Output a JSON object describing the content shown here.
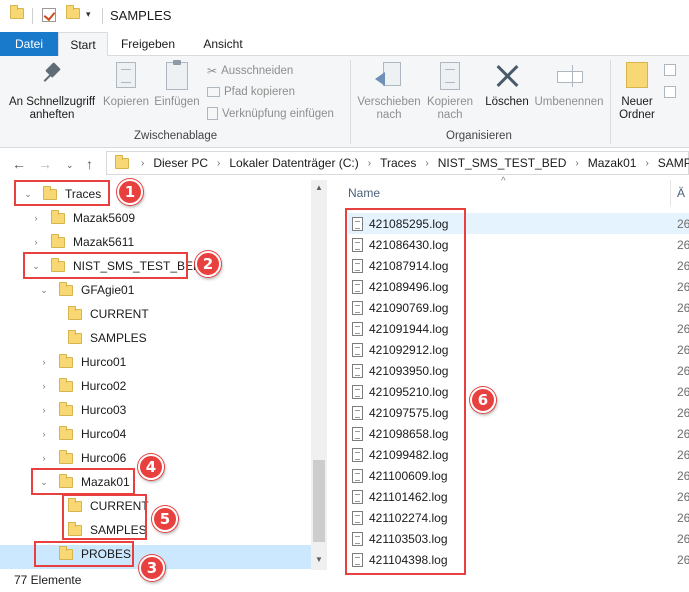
{
  "window": {
    "title": "SAMPLES"
  },
  "ribbon_tabs": [
    {
      "label": "Datei"
    },
    {
      "label": "Start"
    },
    {
      "label": "Freigeben"
    },
    {
      "label": "Ansicht"
    }
  ],
  "ribbon": {
    "pin_label": "An Schnellzugriff anheften",
    "copy_label": "Kopieren",
    "paste_label": "Einfügen",
    "cut_label": "Ausschneiden",
    "copy_path_label": "Pfad kopieren",
    "paste_shortcut_label": "Verknüpfung einfügen",
    "clipboard_group": "Zwischenablage",
    "move_to_label": "Verschieben nach",
    "copy_to_label": "Kopieren nach",
    "delete_label": "Löschen",
    "rename_label": "Umbenennen",
    "organize_group": "Organisieren",
    "new_folder_label": "Neuer Ordner"
  },
  "address": {
    "crumbs": [
      "Dieser PC",
      "Lokaler Datenträger (C:)",
      "Traces",
      "NIST_SMS_TEST_BED",
      "Mazak01",
      "SAMPLES"
    ]
  },
  "tree": [
    {
      "label": "Traces",
      "arrow": "expanded"
    },
    {
      "label": "Mazak5609",
      "arrow": "collapsed"
    },
    {
      "label": "Mazak5611",
      "arrow": "collapsed"
    },
    {
      "label": "NIST_SMS_TEST_BED",
      "arrow": "expanded"
    },
    {
      "label": "GFAgie01",
      "arrow": "expanded"
    },
    {
      "label": "CURRENT",
      "arrow": "none"
    },
    {
      "label": "SAMPLES",
      "arrow": "none"
    },
    {
      "label": "Hurco01",
      "arrow": "collapsed"
    },
    {
      "label": "Hurco02",
      "arrow": "collapsed"
    },
    {
      "label": "Hurco03",
      "arrow": "collapsed"
    },
    {
      "label": "Hurco04",
      "arrow": "collapsed"
    },
    {
      "label": "Hurco06",
      "arrow": "collapsed"
    },
    {
      "label": "Mazak01",
      "arrow": "expanded"
    },
    {
      "label": "CURRENT",
      "arrow": "none"
    },
    {
      "label": "SAMPLES",
      "arrow": "none",
      "selected": true
    },
    {
      "label": "PROBES",
      "arrow": "none"
    }
  ],
  "file_list": {
    "column_name": "Name",
    "column_date_partial": "Ä",
    "files": [
      {
        "name": "421085295.log",
        "date_partial": "26"
      },
      {
        "name": "421086430.log",
        "date_partial": "26"
      },
      {
        "name": "421087914.log",
        "date_partial": "26"
      },
      {
        "name": "421089496.log",
        "date_partial": "26"
      },
      {
        "name": "421090769.log",
        "date_partial": "26"
      },
      {
        "name": "421091944.log",
        "date_partial": "26"
      },
      {
        "name": "421092912.log",
        "date_partial": "26"
      },
      {
        "name": "421093950.log",
        "date_partial": "26"
      },
      {
        "name": "421095210.log",
        "date_partial": "26"
      },
      {
        "name": "421097575.log",
        "date_partial": "26"
      },
      {
        "name": "421098658.log",
        "date_partial": "26"
      },
      {
        "name": "421099482.log",
        "date_partial": "26"
      },
      {
        "name": "421100609.log",
        "date_partial": "26"
      },
      {
        "name": "421101462.log",
        "date_partial": "26"
      },
      {
        "name": "421102274.log",
        "date_partial": "26"
      },
      {
        "name": "421103503.log",
        "date_partial": "26"
      },
      {
        "name": "421104398.log",
        "date_partial": "26"
      }
    ]
  },
  "status": {
    "item_count": "77 Elemente"
  },
  "annotations": {
    "badges": [
      "1",
      "2",
      "3",
      "4",
      "5",
      "6"
    ],
    "color": "#e8403e"
  },
  "colors": {
    "file_tab": "#1979ca",
    "selection": "#cce8ff",
    "folder": "#f8d775"
  }
}
